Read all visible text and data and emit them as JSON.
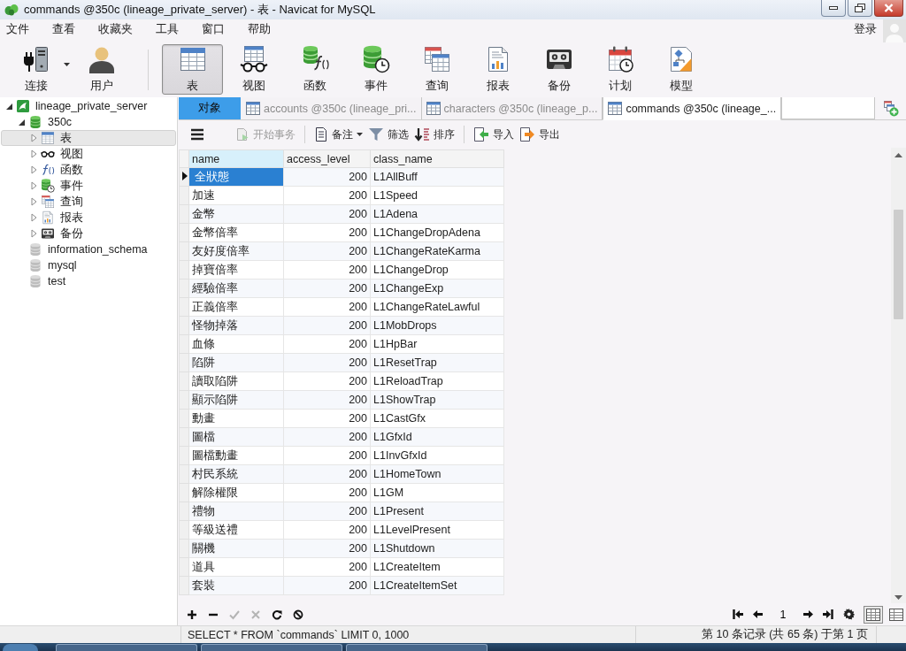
{
  "window": {
    "title": "commands @350c (lineage_private_server) - 表 - Navicat for MySQL"
  },
  "menu": [
    "文件",
    "查看",
    "收藏夹",
    "工具",
    "窗口",
    "帮助"
  ],
  "account": {
    "login": "登录"
  },
  "toolbar": {
    "main": [
      {
        "label": "连接",
        "kind": "connect",
        "dropdown": true
      },
      {
        "label": "用户",
        "kind": "users",
        "dropdown": false
      }
    ],
    "objects": [
      {
        "label": "表",
        "kind": "tables",
        "selected": true
      },
      {
        "label": "视图",
        "kind": "views",
        "selected": false
      },
      {
        "label": "函数",
        "kind": "functions",
        "selected": false
      },
      {
        "label": "事件",
        "kind": "events",
        "selected": false
      },
      {
        "label": "查询",
        "kind": "queries",
        "selected": false
      },
      {
        "label": "报表",
        "kind": "reports",
        "selected": false
      },
      {
        "label": "备份",
        "kind": "backups",
        "selected": false
      },
      {
        "label": "计划",
        "kind": "schedules",
        "selected": false
      },
      {
        "label": "模型",
        "kind": "models",
        "selected": false
      }
    ]
  },
  "sidebar": {
    "tree": [
      {
        "label": "lineage_private_server",
        "kind": "connection",
        "expanded": true,
        "selected": false,
        "children": [
          {
            "label": "350c",
            "kind": "database",
            "opened": true,
            "expanded": true,
            "selected": false,
            "children": [
              {
                "label": "表",
                "kind": "tables",
                "expanded": false,
                "selected": true
              },
              {
                "label": "视图",
                "kind": "views",
                "expanded": false,
                "selected": false
              },
              {
                "label": "函数",
                "kind": "functions",
                "expanded": false,
                "selected": false
              },
              {
                "label": "事件",
                "kind": "events",
                "expanded": false,
                "selected": false
              },
              {
                "label": "查询",
                "kind": "queries",
                "expanded": false,
                "selected": false
              },
              {
                "label": "报表",
                "kind": "reports",
                "expanded": false,
                "selected": false
              },
              {
                "label": "备份",
                "kind": "backups",
                "expanded": false,
                "selected": false
              }
            ]
          },
          {
            "label": "information_schema",
            "kind": "database",
            "opened": false,
            "expanded": false,
            "selected": false
          },
          {
            "label": "mysql",
            "kind": "database",
            "opened": false,
            "expanded": false,
            "selected": false
          },
          {
            "label": "test",
            "kind": "database",
            "opened": false,
            "expanded": false,
            "selected": false
          }
        ]
      }
    ]
  },
  "tabs": [
    {
      "label": "对象",
      "kind": "objects",
      "selected": false
    },
    {
      "label": "accounts @350c (lineage_pri...",
      "kind": "table",
      "selected": false
    },
    {
      "label": "characters @350c (lineage_p...",
      "kind": "table",
      "selected": false
    },
    {
      "label": "commands @350c (lineage_...",
      "kind": "table",
      "selected": true
    }
  ],
  "object_toolbar": {
    "groups": [
      {
        "items": [
          {
            "label": "开始事务",
            "kind": "transaction",
            "disabled": true,
            "dropdown": false
          }
        ]
      },
      {
        "items": [
          {
            "label": "备注",
            "kind": "memo",
            "disabled": false,
            "dropdown": true
          },
          {
            "label": "筛选",
            "kind": "filter",
            "disabled": false,
            "dropdown": false
          },
          {
            "label": "排序",
            "kind": "sort",
            "disabled": false,
            "dropdown": false
          }
        ]
      },
      {
        "items": [
          {
            "label": "导入",
            "kind": "import",
            "disabled": false,
            "dropdown": false
          },
          {
            "label": "导出",
            "kind": "export",
            "disabled": false,
            "dropdown": false
          }
        ]
      }
    ]
  },
  "grid": {
    "columns": [
      {
        "label": "name",
        "kind": "text",
        "selected": true
      },
      {
        "label": "access_level",
        "kind": "number",
        "selected": false
      },
      {
        "label": "class_name",
        "kind": "text",
        "selected": false
      }
    ],
    "rows": [
      {
        "cells": [
          "全狀態",
          "200",
          "L1AllBuff"
        ],
        "selected": true
      },
      {
        "cells": [
          "加速",
          "200",
          "L1Speed"
        ],
        "selected": false
      },
      {
        "cells": [
          "金幣",
          "200",
          "L1Adena"
        ],
        "selected": false
      },
      {
        "cells": [
          "金幣倍率",
          "200",
          "L1ChangeDropAdena"
        ],
        "selected": false
      },
      {
        "cells": [
          "友好度倍率",
          "200",
          "L1ChangeRateKarma"
        ],
        "selected": false
      },
      {
        "cells": [
          "掉寶倍率",
          "200",
          "L1ChangeDrop"
        ],
        "selected": false
      },
      {
        "cells": [
          "經驗倍率",
          "200",
          "L1ChangeExp"
        ],
        "selected": false
      },
      {
        "cells": [
          "正義倍率",
          "200",
          "L1ChangeRateLawful"
        ],
        "selected": false
      },
      {
        "cells": [
          "怪物掉落",
          "200",
          "L1MobDrops"
        ],
        "selected": false
      },
      {
        "cells": [
          "血條",
          "200",
          "L1HpBar"
        ],
        "selected": false
      },
      {
        "cells": [
          "陷阱",
          "200",
          "L1ResetTrap"
        ],
        "selected": false
      },
      {
        "cells": [
          "讀取陷阱",
          "200",
          "L1ReloadTrap"
        ],
        "selected": false
      },
      {
        "cells": [
          "顯示陷阱",
          "200",
          "L1ShowTrap"
        ],
        "selected": false
      },
      {
        "cells": [
          "動畫",
          "200",
          "L1CastGfx"
        ],
        "selected": false
      },
      {
        "cells": [
          "圖檔",
          "200",
          "L1GfxId"
        ],
        "selected": false
      },
      {
        "cells": [
          "圖檔動畫",
          "200",
          "L1InvGfxId"
        ],
        "selected": false
      },
      {
        "cells": [
          "村民系統",
          "200",
          "L1HomeTown"
        ],
        "selected": false
      },
      {
        "cells": [
          "解除權限",
          "200",
          "L1GM"
        ],
        "selected": false
      },
      {
        "cells": [
          "禮物",
          "200",
          "L1Present"
        ],
        "selected": false
      },
      {
        "cells": [
          "等級送禮",
          "200",
          "L1LevelPresent"
        ],
        "selected": false
      },
      {
        "cells": [
          "關機",
          "200",
          "L1Shutdown"
        ],
        "selected": false
      },
      {
        "cells": [
          "道具",
          "200",
          "L1CreateItem"
        ],
        "selected": false
      },
      {
        "cells": [
          "套裝",
          "200",
          "L1CreateItemSet"
        ],
        "selected": false
      }
    ]
  },
  "record_actions": [
    {
      "kind": "add",
      "disabled": false
    },
    {
      "kind": "delete",
      "disabled": false
    },
    {
      "kind": "apply",
      "disabled": true
    },
    {
      "kind": "discard",
      "disabled": true
    },
    {
      "kind": "refresh",
      "disabled": false
    },
    {
      "kind": "stop",
      "disabled": false
    }
  ],
  "pager": {
    "page": "1"
  },
  "view_modes": [
    {
      "kind": "grid",
      "selected": true
    },
    {
      "kind": "form",
      "selected": false
    }
  ],
  "status_bar": {
    "query": "SELECT * FROM `commands` LIMIT 0, 1000",
    "record_info": "第 10 条记录 (共 65 条) 于第 1 页"
  }
}
